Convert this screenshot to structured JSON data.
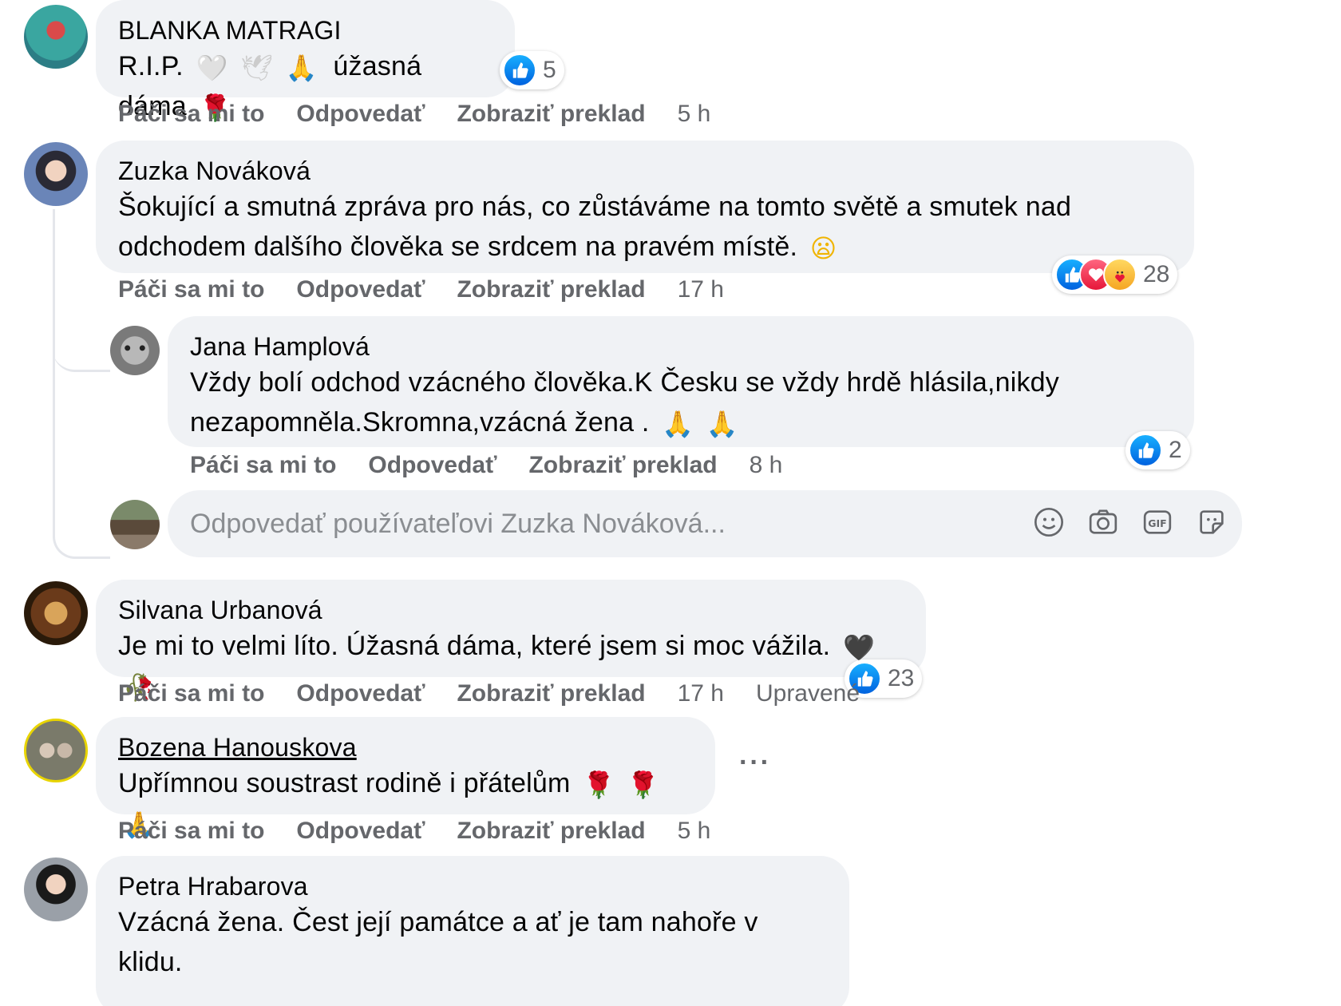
{
  "actions": {
    "like": "Páči sa mi to",
    "reply": "Odpovedať",
    "translate": "Zobraziť preklad"
  },
  "comments": [
    {
      "name": "BLANKA MATRAGI",
      "text": "R.I.P.",
      "emojis": [
        "🤍",
        "🕊",
        "🙏"
      ],
      "text2": "úžasná dáma",
      "emojis2": [
        "🌹"
      ],
      "reaction_count": "5",
      "time": "5 h",
      "avatar_color": "#3aa6a0"
    },
    {
      "name": "Zuzka Nováková",
      "text_line1": "Šokující a smutná zpráva pro nás, co zůstáváme na tomto světě a smutek nad",
      "text_line2": "odchodem dalšího člověka se srdcem na pravém místě.",
      "emojis": [
        "😦"
      ],
      "reaction_count": "28",
      "time": "17 h",
      "avatar_color": "#4a5a78"
    },
    {
      "name": "Silvana Urbanová",
      "text": "Je mi to velmi líto. Úžasná dáma, které jsem si moc vážila.",
      "emojis": [
        "🖤",
        "🥀"
      ],
      "reaction_count": "23",
      "time": "17 h",
      "edited": "Upravené",
      "avatar_color": "#8a5a2a"
    },
    {
      "name": "Bozena Hanouskova",
      "text": "Upřímnou soustrast rodině i přátelům",
      "emojis": [
        "🌹",
        "🌹",
        "🙏"
      ],
      "time": "5 h",
      "more": "···",
      "avatar_color": "#9c9a7e"
    },
    {
      "name": "Petra Hrabarova",
      "text": "Vzácná žena. Čest její památce a ať je tam nahoře v klidu.",
      "avatar_color": "#5a4a4a"
    }
  ],
  "reply": {
    "name": "Jana Hamplová",
    "text_line1": "Vždy bolí odchod vzácného člověka.K Česku se vždy hrdě hlásila,nikdy",
    "text_line2": "nezapomněla.Skromna,vzácná žena .",
    "emojis": [
      "🙏",
      "🙏"
    ],
    "reaction_count": "2",
    "time": "8 h",
    "avatar_color": "#8e8e8e"
  },
  "reply_box": {
    "placeholder": "Odpovedať používateľovi Zuzka Nováková...",
    "icons": [
      "smiley-icon",
      "camera-icon",
      "gif-icon",
      "sticker-icon"
    ]
  }
}
